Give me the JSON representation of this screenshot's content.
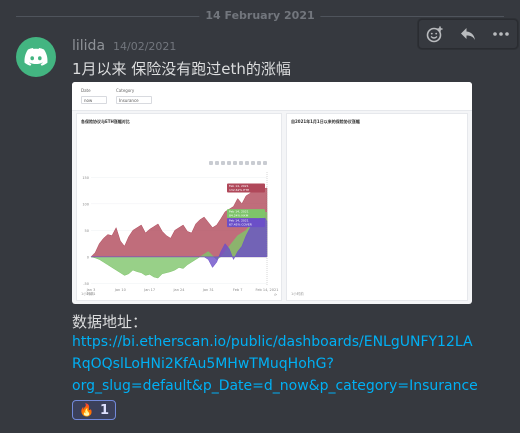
{
  "divider": {
    "date": "14 February 2021"
  },
  "message": {
    "username": "lilida",
    "timestamp": "14/02/2021",
    "text": "1月以来 保险没有跑过eth的涨幅",
    "followup_label": "数据地址：",
    "link_lines": [
      "https://bi.etherscan.io/public/dashboards/ENLgUNFY12LA",
      "RqOQslLoHNi2KfAu5MHwTMuqHohG?",
      "org_slug=default&p_Date=d_now&p_category=Insurance"
    ],
    "reaction": {
      "emoji": "🔥",
      "count": "1"
    }
  },
  "toolbar": {
    "icons": [
      "add-reaction-icon",
      "reply-icon",
      "more-icon"
    ]
  },
  "embed": {
    "filters": {
      "date_label": "Date",
      "date_value": "now",
      "category_label": "Category",
      "category_value": "Insurance"
    },
    "left_panel_title": "各保险协议与ETH涨幅对比",
    "right_panel_title": "自2021年1月1日以来的保险协议涨幅",
    "footer_left": "1小时前",
    "footer_right": "1小时前",
    "chart_data": {
      "type": "area",
      "x": [
        "Jan 3",
        "Jan 4",
        "Jan 5",
        "Jan 6",
        "Jan 7",
        "Jan 8",
        "Jan 9",
        "Jan 10",
        "Jan 11",
        "Jan 12",
        "Jan 13",
        "Jan 14",
        "Jan 15",
        "Jan 16",
        "Jan 17",
        "Jan 18",
        "Jan 19",
        "Jan 20",
        "Jan 21",
        "Jan 22",
        "Jan 23",
        "Jan 24",
        "Jan 25",
        "Jan 26",
        "Jan 27",
        "Jan 28",
        "Jan 29",
        "Jan 30",
        "Jan 31",
        "Feb 1",
        "Feb 2",
        "Feb 3",
        "Feb 4",
        "Feb 5",
        "Feb 6",
        "Feb 7",
        "Feb 8",
        "Feb 9",
        "Feb 10",
        "Feb 11",
        "Feb 12",
        "Feb 13",
        "Feb 14"
      ],
      "xticks": [
        "Jan 3\n2021",
        "Jan 10",
        "Jan 17",
        "Jan 24",
        "Jan 31",
        "Feb 7",
        "Feb 14, 2021"
      ],
      "ylim": [
        -55,
        160
      ],
      "yticks": [
        "150",
        "100",
        "50",
        "0",
        "-50"
      ],
      "series": [
        {
          "name": "ETH",
          "color": "#b0485a",
          "values": [
            0,
            8,
            25,
            35,
            42,
            40,
            55,
            30,
            20,
            38,
            50,
            55,
            60,
            45,
            52,
            57,
            62,
            48,
            40,
            35,
            50,
            55,
            60,
            48,
            45,
            62,
            70,
            75,
            65,
            55,
            60,
            72,
            85,
            90,
            95,
            110,
            100,
            115,
            120,
            130,
            125,
            128,
            130
          ]
        },
        {
          "name": "NXM",
          "color": "#7ec46a",
          "values": [
            0,
            -2,
            -5,
            -10,
            -15,
            -20,
            -25,
            -30,
            -35,
            -32,
            -25,
            -28,
            -30,
            -35,
            -33,
            -38,
            -40,
            -32,
            -30,
            -28,
            -25,
            -20,
            -22,
            -15,
            -10,
            -5,
            0,
            5,
            10,
            2,
            -5,
            0,
            10,
            20,
            30,
            40,
            45,
            50,
            60,
            65,
            80,
            85,
            84
          ]
        },
        {
          "name": "COVER",
          "color": "#6b4fc8",
          "values": [
            0,
            0,
            0,
            0,
            0,
            0,
            0,
            0,
            0,
            0,
            0,
            0,
            0,
            0,
            0,
            0,
            0,
            0,
            0,
            0,
            0,
            0,
            0,
            0,
            0,
            0,
            0,
            0,
            -5,
            -20,
            -10,
            10,
            25,
            15,
            -5,
            10,
            20,
            40,
            55,
            60,
            70,
            80,
            67
          ]
        }
      ],
      "tooltips": [
        {
          "date": "Feb 14, 2021",
          "series": "ETH",
          "value": "132.62%"
        },
        {
          "date": "Feb 14, 2021",
          "series": "NXM",
          "value": "84.24%"
        },
        {
          "date": "Feb 14, 2021",
          "series": "COVER",
          "value": "67.45%"
        }
      ]
    }
  }
}
